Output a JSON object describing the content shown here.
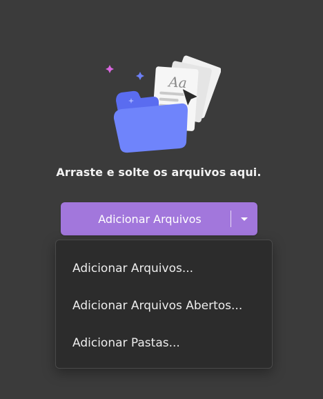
{
  "dropzone": {
    "instruction": "Arraste e solte os arquivos aqui."
  },
  "add_button": {
    "label": "Adicionar Arquivos",
    "dropdown_icon": "caret-down-icon"
  },
  "menu": {
    "items": [
      {
        "label": "Adicionar Arquivos..."
      },
      {
        "label": "Adicionar Arquivos Abertos..."
      },
      {
        "label": "Adicionar Pastas..."
      }
    ]
  },
  "colors": {
    "background": "#3b3b3b",
    "accent": "#a277dc",
    "menu_background": "#2c2c2c",
    "folder": "#6b7cf6"
  },
  "icons": {
    "illustration": "folder-with-documents-illustration",
    "sparkles": "sparkle-icon",
    "cursor": "pointer-cursor-icon"
  }
}
